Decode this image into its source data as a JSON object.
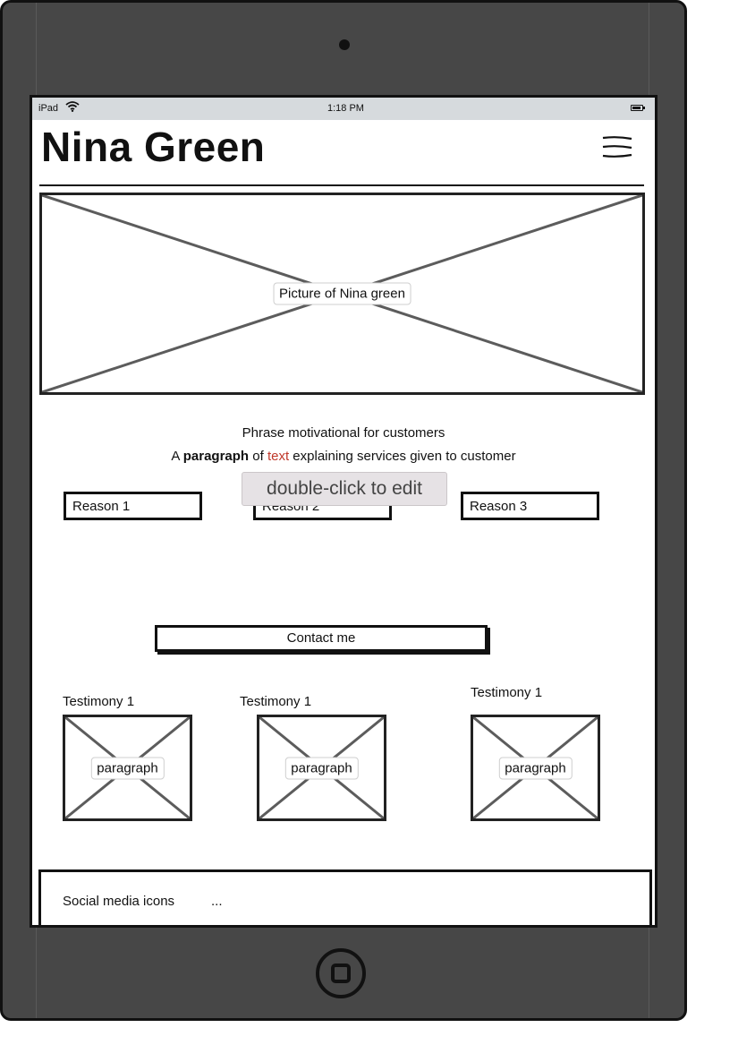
{
  "device": {
    "status_bar": {
      "carrier": "iPad",
      "wifi_icon": "wifi-icon",
      "time": "1:18 PM",
      "battery_icon": "battery-icon"
    }
  },
  "header": {
    "title": "Nina Green",
    "menu_icon": "hamburger-menu-icon"
  },
  "hero": {
    "image_label": "Picture of Nina green"
  },
  "intro": {
    "phrase": "Phrase motivational for customers",
    "paragraph": {
      "prefix": "A ",
      "bold": "paragraph",
      "middle": " of ",
      "accent": "text",
      "suffix": " explaining services given to customer"
    }
  },
  "reasons": [
    {
      "label": "Reason 1"
    },
    {
      "label": "Reason 2"
    },
    {
      "label": "Reason 3"
    }
  ],
  "tooltip": "double-click to edit",
  "contact_button": "Contact me",
  "testimonies": [
    {
      "title": "Testimony 1",
      "body": "paragraph"
    },
    {
      "title": "Testimony 1",
      "body": "paragraph"
    },
    {
      "title": "Testimony 1",
      "body": "paragraph"
    }
  ],
  "footer": {
    "label": "Social media icons",
    "ellipsis": "..."
  },
  "colors": {
    "device_body": "#474747",
    "status_bar": "#d6dadd",
    "accent_text": "#c0392b",
    "tooltip_bg": "#e6e2e5"
  }
}
